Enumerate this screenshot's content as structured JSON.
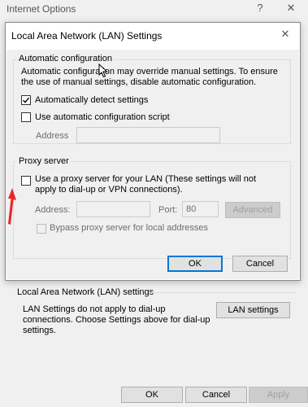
{
  "parent": {
    "title": "Internet Options",
    "help_glyph": "?",
    "close_glyph": "✕",
    "lan_group_label": "Local Area Network (LAN) settings",
    "lan_info": "LAN Settings do not apply to dial-up connections. Choose Settings above for dial-up settings.",
    "lan_settings_button": "LAN settings",
    "ok_button": "OK",
    "cancel_button": "Cancel",
    "apply_button": "Apply"
  },
  "dialog": {
    "title": "Local Area Network (LAN) Settings",
    "close_glyph": "✕",
    "auto_config": {
      "legend": "Automatic configuration",
      "description": "Automatic configuration may override manual settings.  To ensure the use of manual settings, disable automatic configuration.",
      "auto_detect_label": "Automatically detect settings",
      "auto_detect_checked": true,
      "use_script_label": "Use automatic configuration script",
      "use_script_checked": false,
      "address_label": "Address",
      "address_value": ""
    },
    "proxy": {
      "legend": "Proxy server",
      "use_proxy_label": "Use a proxy server for your LAN (These settings will not apply to dial-up or VPN connections).",
      "use_proxy_checked": false,
      "address_label": "Address:",
      "address_value": "",
      "port_label": "Port:",
      "port_value": "80",
      "advanced_button": "Advanced",
      "bypass_label": "Bypass proxy server for local addresses",
      "bypass_checked": false
    },
    "ok_button": "OK",
    "cancel_button": "Cancel"
  },
  "colors": {
    "accent": "#0078d7",
    "arrow": "#e8262b",
    "window_bg": "#f0f0f0",
    "dialog_bg": "#ffffff"
  }
}
